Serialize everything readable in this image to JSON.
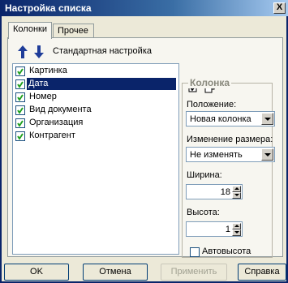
{
  "window": {
    "title": "Настройка списка",
    "close_label": "X"
  },
  "tabs": [
    {
      "label": "Колонки"
    },
    {
      "label": "Прочее"
    }
  ],
  "toolbar": {
    "default_settings_label": "Стандартная настройка"
  },
  "columns_list": {
    "items": [
      {
        "label": "Картинка",
        "checked": true,
        "selected": false
      },
      {
        "label": "Дата",
        "checked": true,
        "selected": true
      },
      {
        "label": "Номер",
        "checked": true,
        "selected": false
      },
      {
        "label": "Вид документа",
        "checked": true,
        "selected": false
      },
      {
        "label": "Организация",
        "checked": true,
        "selected": false
      },
      {
        "label": "Контрагент",
        "checked": true,
        "selected": false
      }
    ]
  },
  "column_group": {
    "title": "Колонка",
    "position_label": "Положение:",
    "position_value": "Новая колонка",
    "resize_label": "Изменение размера:",
    "resize_value": "Не изменять",
    "width_label": "Ширина:",
    "width_value": "18",
    "height_label": "Высота:",
    "height_value": "1",
    "auto_height_label": "Автовысота",
    "auto_height_checked": false
  },
  "buttons": {
    "ok": "OK",
    "cancel": "Отмена",
    "apply": "Применить",
    "help": "Справка"
  },
  "colors": {
    "title_bar": "#0a246a",
    "selection": "#0a246a",
    "arrow_icon": "#1f3d99"
  }
}
